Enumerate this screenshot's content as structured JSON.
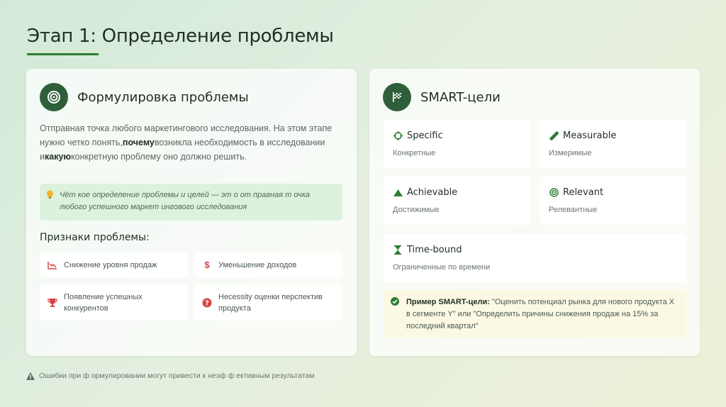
{
  "page": {
    "title": "Этап 1: Определение проблемы",
    "accent_color": "#2e7d32",
    "icon_bg_color": "#2e5e3a"
  },
  "left_card": {
    "title": "Формулировка проблемы",
    "icon": "target-icon",
    "intro": {
      "part1": "Отправная точка любого маркетингового исследования. На этом этапе нужно четко понять,",
      "bold1": "почему",
      "part2": "возникла необходимость в исследовании и",
      "bold2": "какую",
      "part3": "конкретную проблему оно должно решить."
    },
    "quote": {
      "icon": "lightbulb-icon",
      "text": "Чёт кое определение проблемы и целей — эт о от правная т очка любого успешного маркет ингового исследования"
    },
    "signs_title": "Признаки проблемы:",
    "signs": [
      {
        "icon": "chart-down-icon",
        "label": "Снижение уровня продаж"
      },
      {
        "icon": "dollar-icon",
        "label": "Уменьшение доходов"
      },
      {
        "icon": "trophy-icon",
        "label": "Появление успешных конкурентов"
      },
      {
        "icon": "question-icon",
        "label": "Hecessity оценки перспектив продукта"
      }
    ]
  },
  "right_card": {
    "title": "SMART-цели",
    "icon": "flag-icon",
    "items": [
      {
        "icon": "crosshair-icon",
        "label": "Specific",
        "sub": "Конкретные"
      },
      {
        "icon": "ruler-icon",
        "label": "Measurable",
        "sub": "Измеримые"
      },
      {
        "icon": "mountain-icon",
        "label": "Achievable",
        "sub": "Достижимые"
      },
      {
        "icon": "bullseye-icon",
        "label": "Relevant",
        "sub": "Релевантные"
      },
      {
        "icon": "hourglass-icon",
        "label": "Time-bound",
        "sub": "Ограниченные по времени"
      }
    ],
    "example": {
      "icon": "check-circle-icon",
      "bold": "Пример SMART-цели:",
      "text": " \"Оценить потенциал рынка для нового продукта X в сегменте Y\" или \"Определить причины снижения продаж на 15% за последний квартал\""
    }
  },
  "footer": {
    "icon": "warning-icon",
    "text": "Ошибки при ф ормулировании могут привести к неэф ф ективным результатам"
  }
}
